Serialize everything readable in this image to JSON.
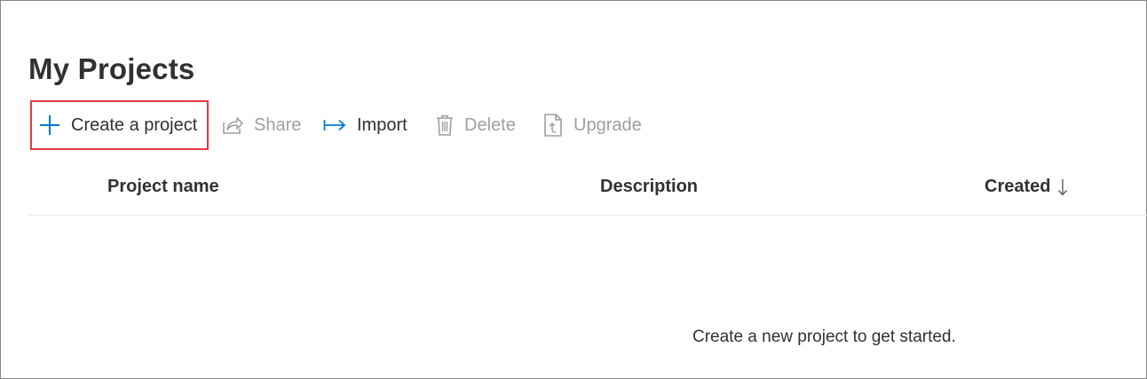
{
  "page": {
    "title": "My Projects"
  },
  "toolbar": {
    "create": {
      "label": "Create a project",
      "icon": "plus-icon"
    },
    "share": {
      "label": "Share",
      "icon": "share-icon",
      "disabled": true
    },
    "import": {
      "label": "Import",
      "icon": "import-arrow-icon"
    },
    "delete": {
      "label": "Delete",
      "icon": "trash-icon",
      "disabled": true
    },
    "upgrade": {
      "label": "Upgrade",
      "icon": "upgrade-file-icon",
      "disabled": true
    }
  },
  "table": {
    "columns": [
      {
        "label": "Project name"
      },
      {
        "label": "Description"
      },
      {
        "label": "Created",
        "sort": "descending"
      }
    ],
    "rows": [],
    "empty_message": "Create a new project to get started."
  },
  "colors": {
    "accent": "#0078d4",
    "highlight_border": "#e1393f",
    "disabled_text": "#a19f9d",
    "text": "#323130"
  }
}
